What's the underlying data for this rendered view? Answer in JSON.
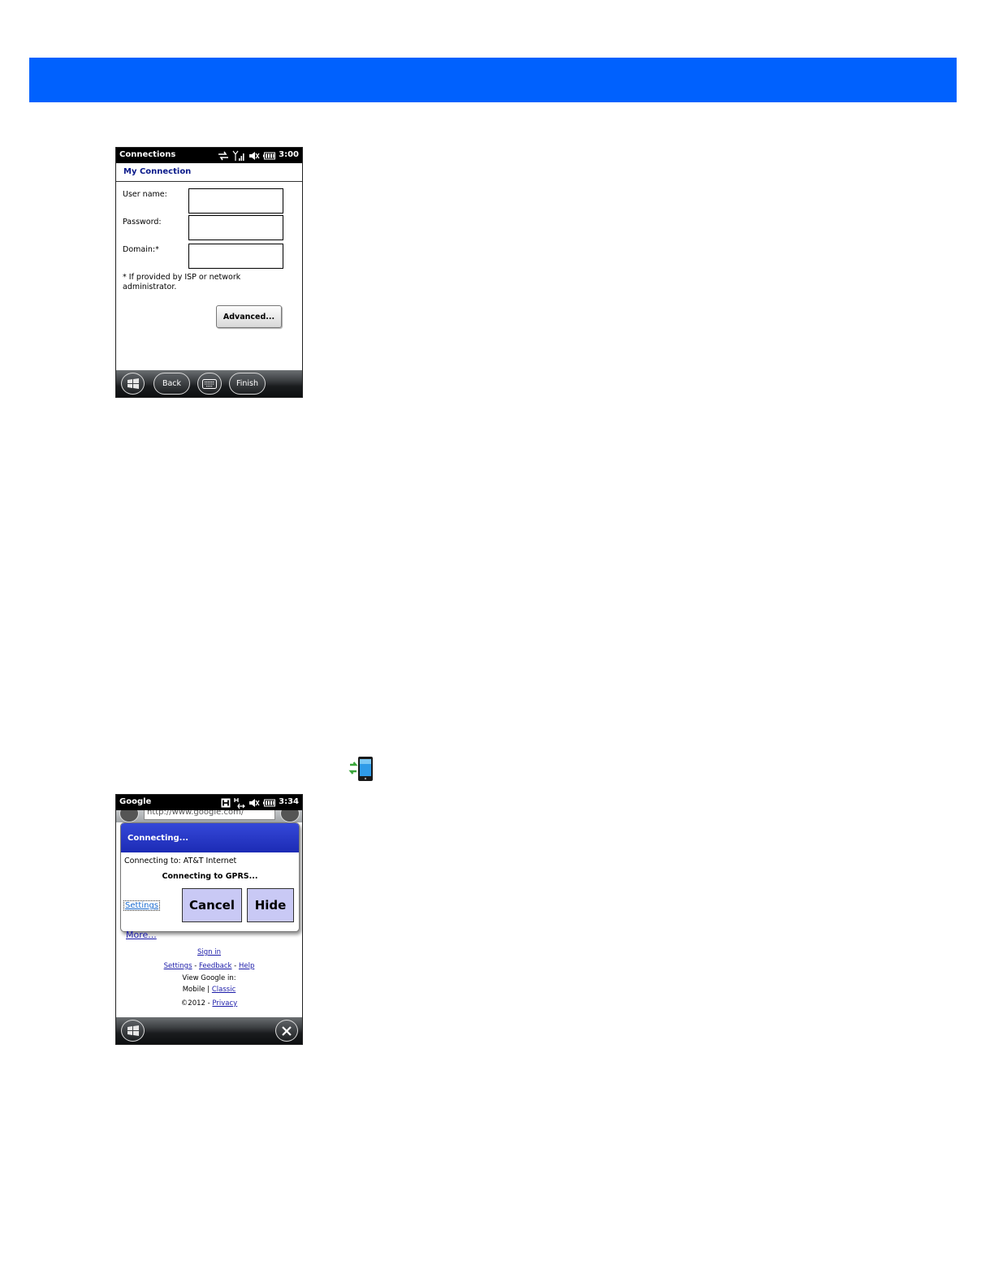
{
  "colors": {
    "banner": "#0061fe",
    "dialog_header": "#2236c6",
    "link": "#1a1aa8",
    "dialog_button": "#c9c9f5"
  },
  "screen1": {
    "statusbar": {
      "title": "Connections",
      "time": "3:00",
      "icons": [
        "sync-arrows-icon",
        "signal-icon",
        "speaker-muted-icon",
        "battery-icon"
      ]
    },
    "header": "My Connection",
    "fields": [
      {
        "label": "User name:",
        "value": ""
      },
      {
        "label": "Password:",
        "value": ""
      },
      {
        "label": "Domain:*",
        "value": ""
      }
    ],
    "note": "* If provided by ISP or network administrator.",
    "advanced_label": "Advanced...",
    "taskbar": {
      "start_icon": "windows-flag-icon",
      "back_label": "Back",
      "keyboard_icon": "keyboard-icon",
      "finish_label": "Finish"
    }
  },
  "connection_icon": "phone-connection-icon",
  "screen2": {
    "statusbar": {
      "title": "Google",
      "time": "3:34",
      "icons": [
        "hspa-icon",
        "data-arrows-icon",
        "speaker-muted-icon",
        "battery-icon"
      ]
    },
    "url": "http://www.google.com/",
    "dialog": {
      "title": "Connecting...",
      "connecting_to": "Connecting to: AT&T Internet",
      "status": "Connecting to GPRS...",
      "settings_link": "Settings",
      "cancel_label": "Cancel",
      "hide_label": "Hide"
    },
    "more_link": "More...",
    "sign_in": "Sign in",
    "links": {
      "settings": "Settings",
      "feedback": "Feedback",
      "help": "Help",
      "sep": " - "
    },
    "view_in": "View Google in:",
    "mobile": "Mobile",
    "pipe": " | ",
    "classic": "Classic",
    "copyright": "©2012",
    "privacy": "Privacy"
  }
}
